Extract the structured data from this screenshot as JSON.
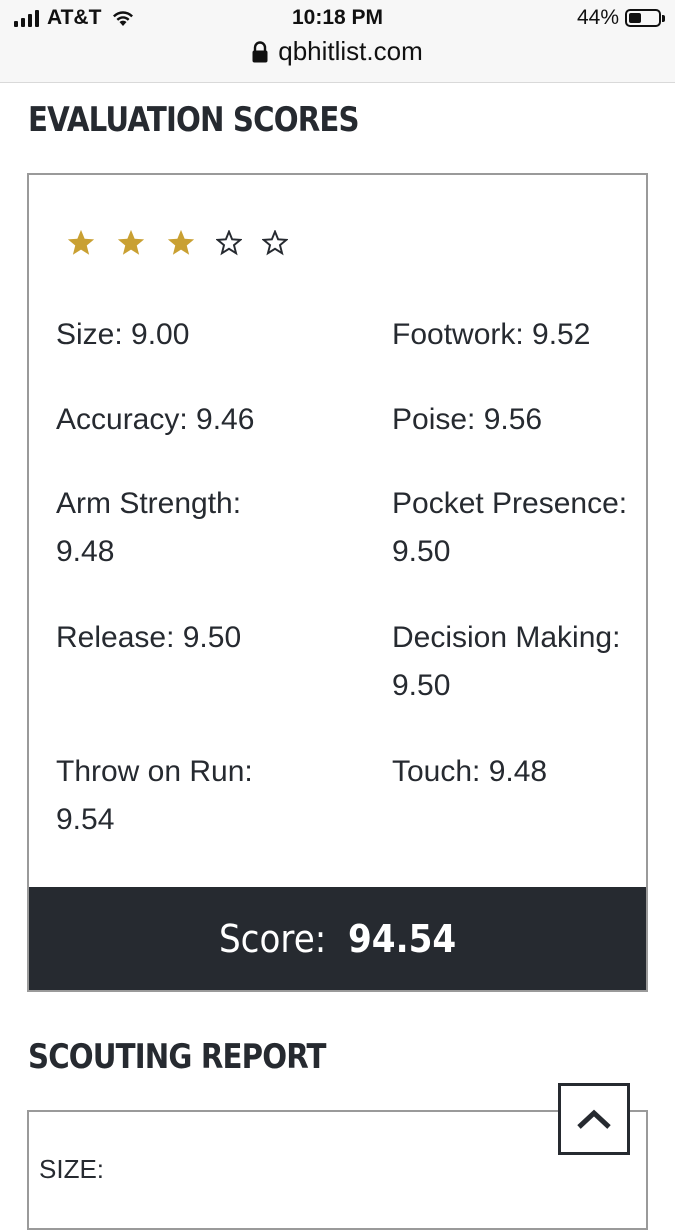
{
  "status_bar": {
    "carrier": "AT&T",
    "time": "10:18 PM",
    "battery": "44%",
    "battery_level": 0.44,
    "url": "qbhitlist.com"
  },
  "evaluation": {
    "title": "EVALUATION SCORES",
    "rating": {
      "filled": 3,
      "total": 5,
      "fill_color": "#c9a032"
    },
    "metrics": [
      {
        "label": "Size: 9.00"
      },
      {
        "label": "Footwork: 9.52"
      },
      {
        "label": "Accuracy: 9.46"
      },
      {
        "label": "Poise: 9.56"
      },
      {
        "label": "Arm Strength: 9.48"
      },
      {
        "label": "Pocket Presence: 9.50"
      },
      {
        "label": "Release: 9.50"
      },
      {
        "label": "Decision Making: 9.50"
      },
      {
        "label": "Throw on Run: 9.54"
      },
      {
        "label": "Touch: 9.48"
      }
    ],
    "score_label": "Score:",
    "score_value": "94.54"
  },
  "scouting": {
    "title": "SCOUTING REPORT",
    "first_label": "SIZE:"
  },
  "colors": {
    "dark": "#262a30",
    "border": "#9a9a9a",
    "star_gold": "#c9a032"
  }
}
